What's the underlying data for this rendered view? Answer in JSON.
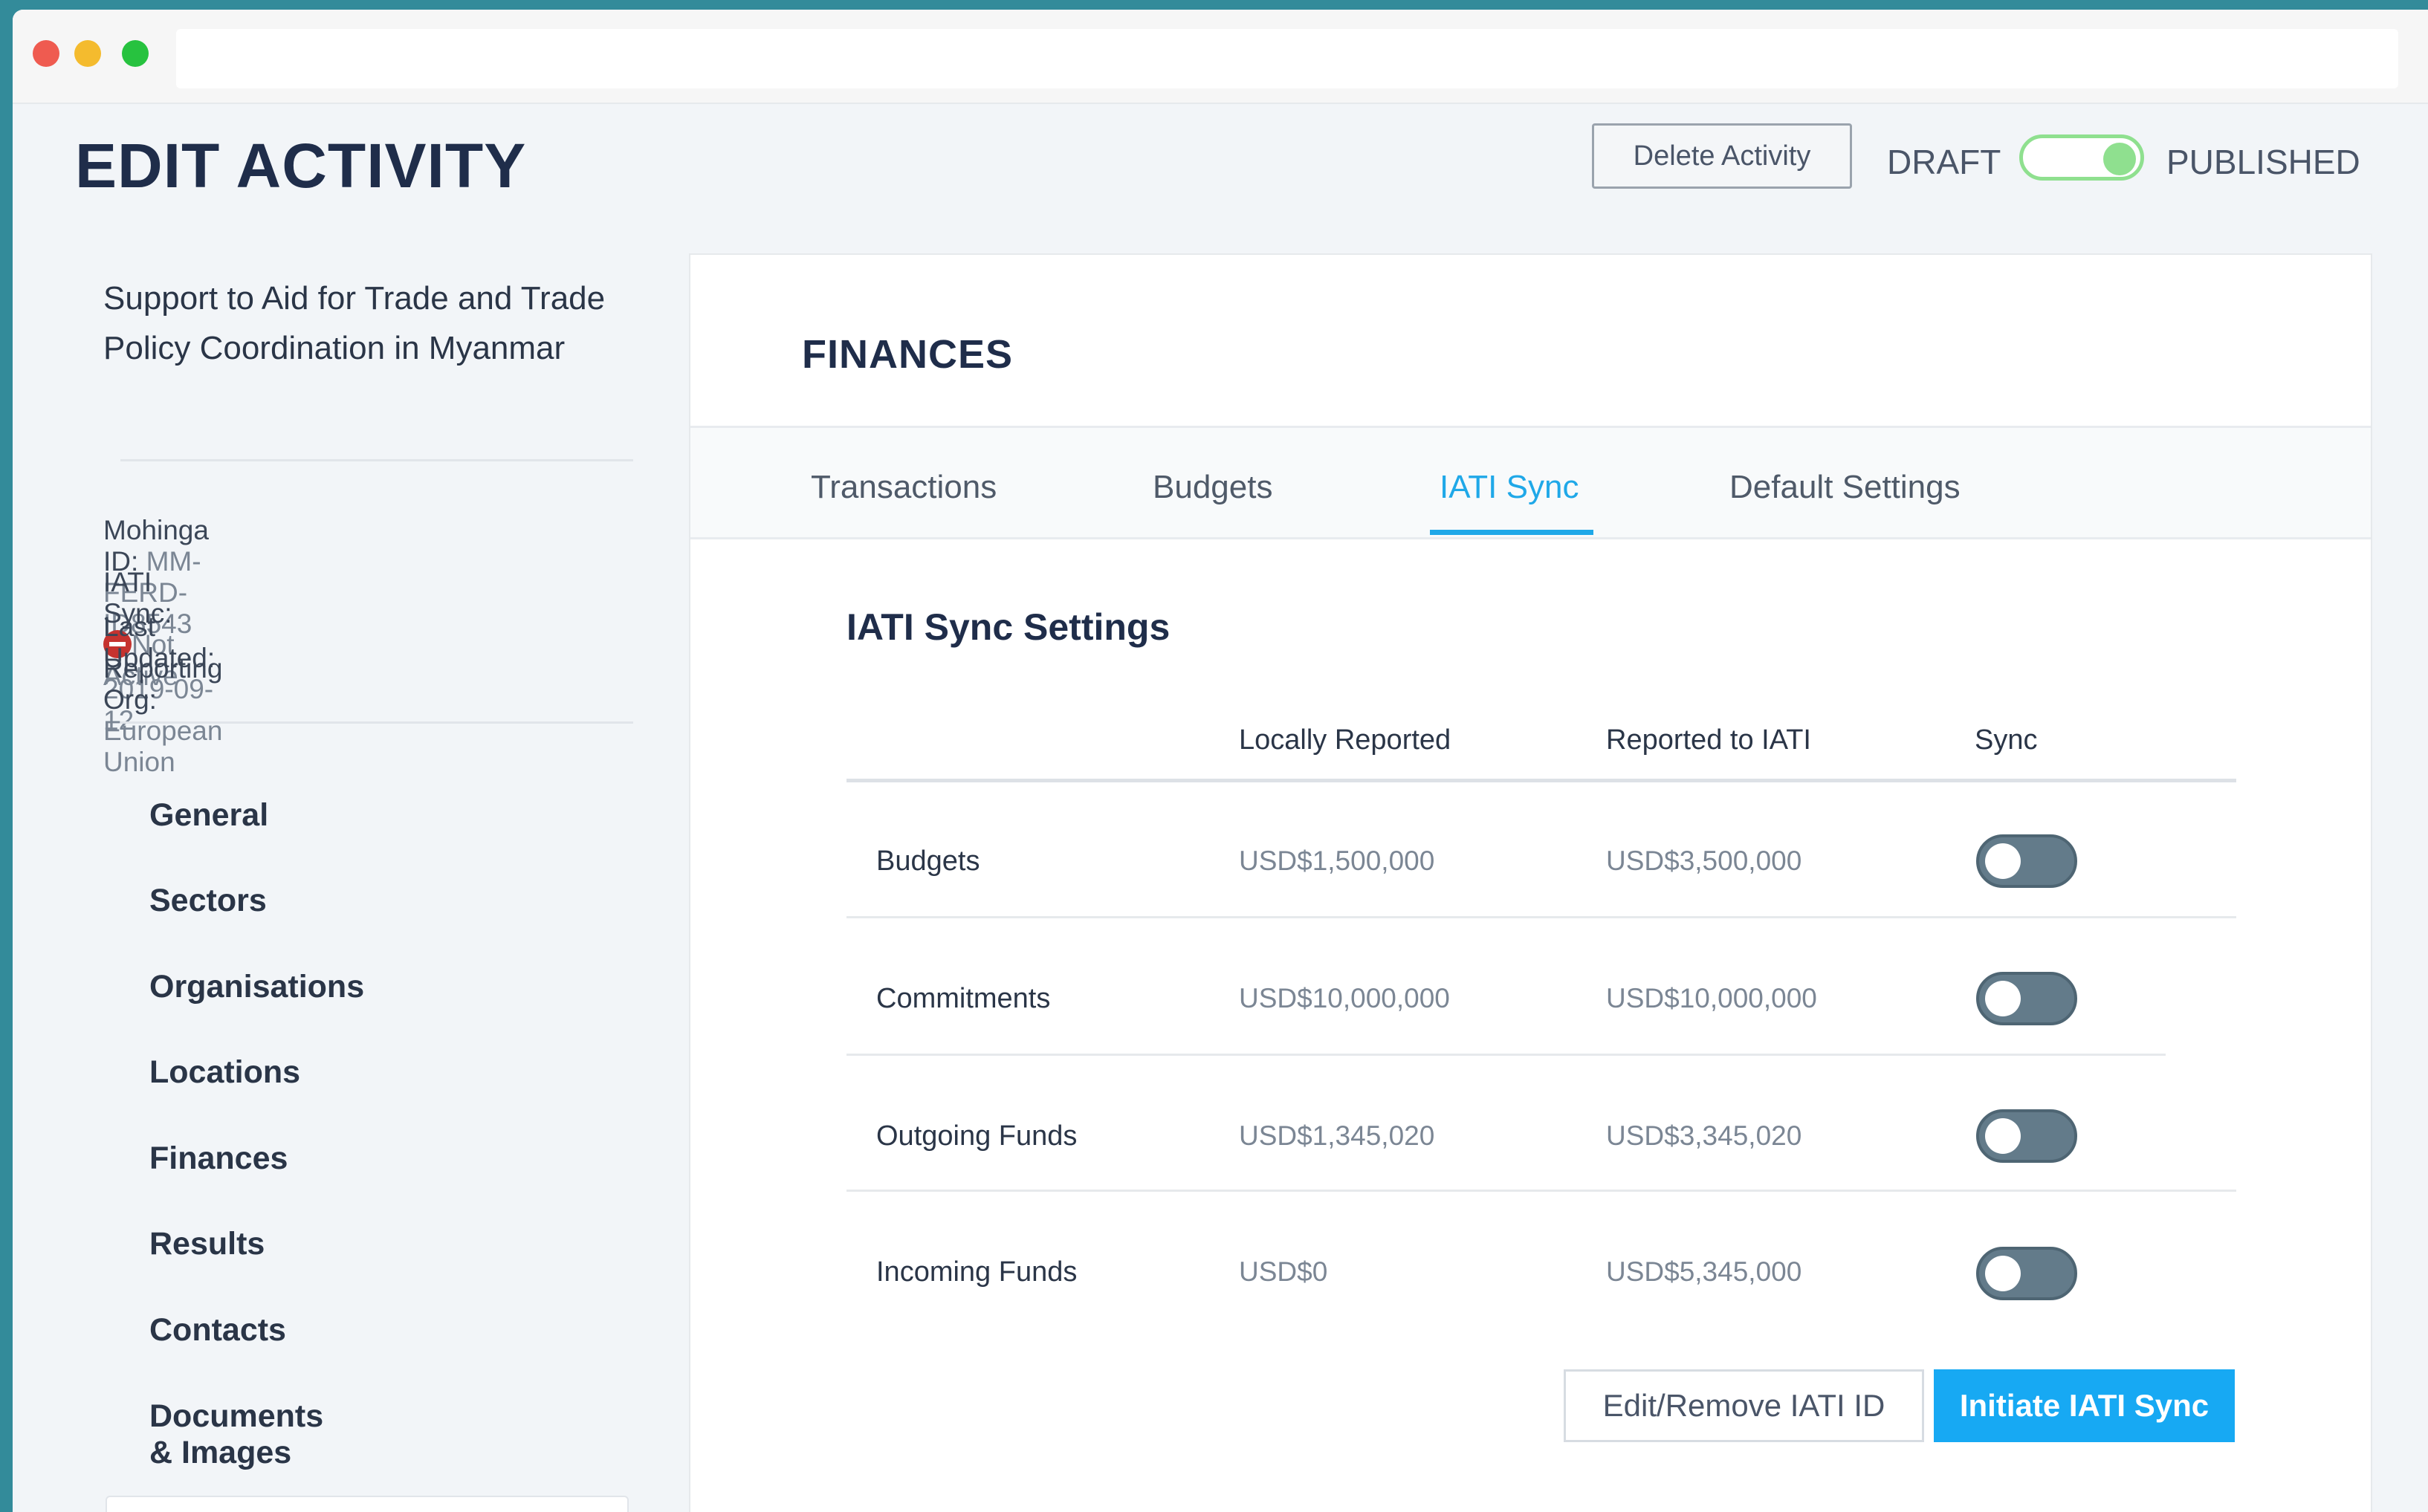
{
  "header": {
    "title": "EDIT ACTIVITY",
    "delete_label": "Delete Activity",
    "draft_label": "DRAFT",
    "published_label": "PUBLISHED"
  },
  "sidebar": {
    "activity_name": "Support to Aid for Trade and Trade Policy Coordination in Myanmar",
    "meta": {
      "mohinga_id_label": "Mohinga ID:",
      "mohinga_id": "MM-FERD-ID8543",
      "iati_sync_label": "IATI Sync:",
      "iati_sync_status": "Not Active",
      "last_updated_label": "Last Updated:",
      "last_updated": "2019-09-12",
      "reporting_org_label": "Reporting Org:",
      "reporting_org": "European Union"
    },
    "nav": [
      "General",
      "Sectors",
      "Organisations",
      "Locations",
      "Finances",
      "Results",
      "Contacts",
      "Documents & Images"
    ]
  },
  "card": {
    "title": "FINANCES",
    "tabs": [
      "Transactions",
      "Budgets",
      "IATI Sync",
      "Default Settings"
    ],
    "active_tab": "IATI Sync",
    "section_title": "IATI Sync Settings",
    "columns": [
      "Locally Reported",
      "Reported to IATI",
      "Sync"
    ],
    "rows": [
      {
        "label": "Budgets",
        "local": "USD$1,500,000",
        "iati": "USD$3,500,000",
        "sync": false
      },
      {
        "label": "Commitments",
        "local": "USD$10,000,000",
        "iati": "USD$10,000,000",
        "sync": false
      },
      {
        "label": "Outgoing Funds",
        "local": "USD$1,345,020",
        "iati": "USD$3,345,020",
        "sync": false
      },
      {
        "label": "Incoming Funds",
        "local": "USD$0",
        "iati": "USD$5,345,000",
        "sync": false
      }
    ],
    "edit_button": "Edit/Remove IATI ID",
    "sync_button": "Initiate IATI Sync"
  },
  "colors": {
    "accent": "#17a9f3",
    "published_toggle": "#8fe08f",
    "not_active": "#c5332f",
    "frame": "#338b9a"
  },
  "icons": {
    "status": "stop-icon"
  }
}
